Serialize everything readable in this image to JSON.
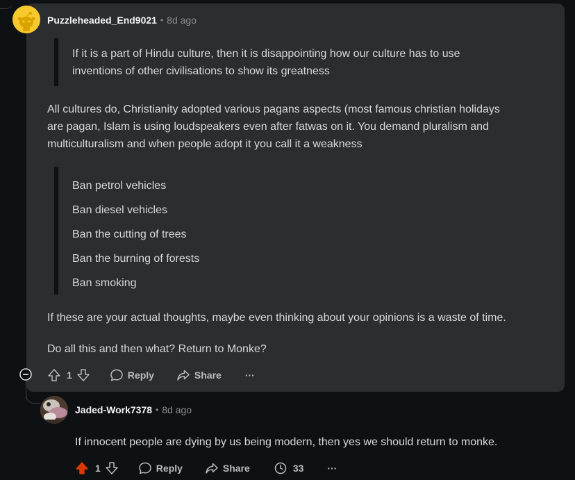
{
  "comment1": {
    "username": "Puzzleheaded_End9021",
    "separator": "•",
    "time": "8d ago",
    "quote1": {
      "line1": "If it is a part of Hindu culture, then it is disappointing how our culture has to use",
      "line2": "inventions of other civilisations to show its greatness"
    },
    "para1": {
      "line1": "All cultures do, Christianity adopted various pagans aspects (most famous christian holidays",
      "line2": "are pagan, Islam is using loudspeakers even after fatwas on it. You demand pluralism and",
      "line3": "multiculturalism and when people adopt it you call it a weakness"
    },
    "quote2": {
      "items": [
        "Ban petrol vehicles",
        "Ban diesel vehicles",
        "Ban the cutting of trees",
        "Ban the burning of forests",
        "Ban smoking"
      ]
    },
    "para2": "If these are your actual thoughts, maybe even thinking about your opinions is a waste of time.",
    "para3": "Do all this and then what? Return to Monke?",
    "actions": {
      "score": "1",
      "reply": "Reply",
      "share": "Share",
      "more": "···"
    }
  },
  "comment2": {
    "username": "Jaded-Work7378",
    "separator": "•",
    "time": "8d ago",
    "body": "If innocent people are dying by us being modern, then yes we should return to monke.",
    "actions": {
      "score": "1",
      "reply": "Reply",
      "share": "Share",
      "awards": "33",
      "more": "···"
    }
  },
  "colors": {
    "upvote_active": "#d93900",
    "highlight_bg": "#2a2e31",
    "page_bg": "#0e1113"
  }
}
